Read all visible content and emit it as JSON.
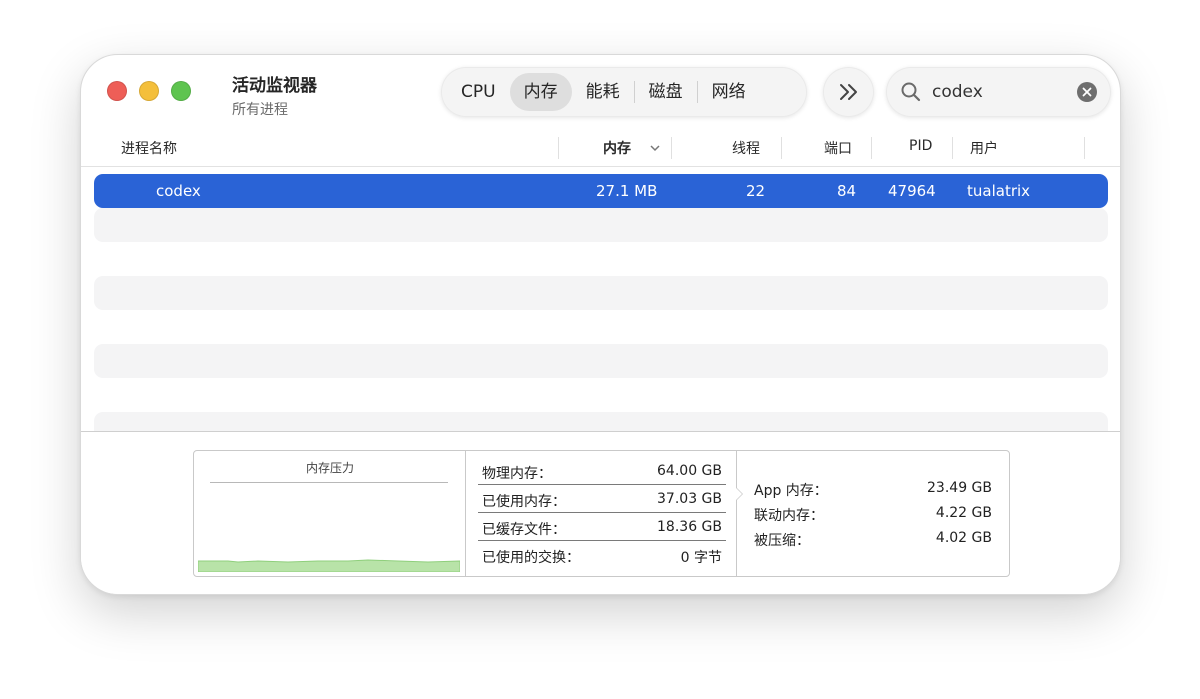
{
  "window": {
    "title": "活动监视器",
    "subtitle": "所有进程"
  },
  "tabs": [
    {
      "label": "CPU",
      "selected": false
    },
    {
      "label": "内存",
      "selected": true
    },
    {
      "label": "能耗",
      "selected": false
    },
    {
      "label": "磁盘",
      "selected": false
    },
    {
      "label": "网络",
      "selected": false
    }
  ],
  "toolbar": {
    "more_icon": "chevron-double-right-icon"
  },
  "search": {
    "value": "codex",
    "icon": "search-icon",
    "clear_icon": "clear-icon"
  },
  "columns": {
    "name": "进程名称",
    "memory": "内存",
    "threads": "线程",
    "ports": "端口",
    "pid": "PID",
    "user": "用户"
  },
  "processes": [
    {
      "name": "codex",
      "memory": "27.1 MB",
      "threads": "22",
      "ports": "84",
      "pid": "47964",
      "user": "tualatrix"
    }
  ],
  "memory_pressure": {
    "title": "内存压力",
    "level_fraction": 0.08,
    "color": "#b8e3a8"
  },
  "memory_stats": [
    {
      "label": "物理内存：",
      "value": "64.00 GB"
    },
    {
      "label": "已使用内存：",
      "value": "37.03 GB"
    },
    {
      "label": "已缓存文件：",
      "value": "18.36 GB"
    },
    {
      "label": "已使用的交换：",
      "value": "0 字节"
    }
  ],
  "used_breakdown": [
    {
      "label": "App 内存：",
      "value": "23.49 GB"
    },
    {
      "label": "联动内存：",
      "value": "4.22 GB"
    },
    {
      "label": "被压缩：",
      "value": "4.02 GB"
    }
  ],
  "colors": {
    "selection": "#2a63d6",
    "stripe": "#f4f4f5"
  }
}
